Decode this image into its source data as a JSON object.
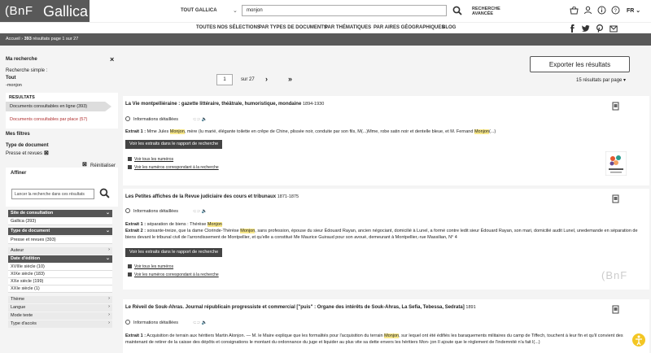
{
  "header": {
    "logo_bnf": "(BnF",
    "logo_gallica": "Gallica",
    "library": "TOUT GALLICA",
    "search_value": "monjon",
    "advanced_line1": "RECHERCHE",
    "advanced_line2": "AVANCÉE",
    "lang": "FR"
  },
  "nav": {
    "items": [
      "TOUTES NOS SÉLECTIONS",
      "PAR TYPES DE DOCUMENTS",
      "PAR THÉMATIQUES",
      "PAR AIRES GÉOGRAPHIQUES",
      "BLOG"
    ]
  },
  "breadcrumb": {
    "home": "Accueil",
    "count": "393",
    "rest": "résultats page 1 sur 27"
  },
  "sidebar": {
    "ma_recherche": "Ma recherche",
    "close": "×",
    "simple_label": "Recherche simple :",
    "scope": "Tout",
    "term": "-monjon",
    "resultats": "RESULTATS",
    "online": "Documents consultables en ligne (393)",
    "onsite": "Documents consultables par place (57)",
    "mes_filtres": "Mes filtres",
    "type_doc": "Type de document",
    "presse": "Presse et revues",
    "reset": "Réinitialiser",
    "affiner": "Affiner",
    "affiner_placeholder": "Lancer la recherche dans ces résultats",
    "facet_site": "Site de consultation",
    "gallica": "Gallica (393)",
    "facet_type": "Type de document",
    "presse_count": "Presse et revues (393)",
    "facet_auteur": "Auteur",
    "facet_date": "Date d'édition",
    "centuries": [
      "XVIIIe siècle (10)",
      "XIXe siècle (183)",
      "XXe siècle (199)",
      "XXIe siècle (1)"
    ],
    "facets_more": [
      "Thème",
      "Langue",
      "Mode texte",
      "Type d'accès"
    ]
  },
  "toolbar": {
    "export": "Exporter les résultats",
    "page_value": "1",
    "sur": "sur 27",
    "per_page": "15 résultats par page"
  },
  "results": [
    {
      "title": "La Vie montpelliéraine : gazette littéraire, théâtrale, humoristique, mondaine",
      "years": "1894-1930",
      "details": "Informations détaillées",
      "e1_label": "Extrait 1 :",
      "e1_pre": " Mme Jules ",
      "e1_mark": "Monjon",
      "e1_mid": ", mère (lu marié, élégante toilette en crêpe de Chine, plissée noir, conduite par son fils, M(...)Mme, robe satin noir et dentelle bleue, et M. Fernand ",
      "e1_mark2": "Monjon",
      "e1_post": "(...)",
      "button": "Voir les extraits dans le rapport de recherche",
      "link1": "Voir tous les numéros",
      "link2": "Voir les numéros correspondant à la recherche"
    },
    {
      "title": "Les Petites affiches de la Revue judiciaire des cours et tribunaux",
      "years": "1871-1875",
      "details": "Informations détaillées",
      "e1_label": "Extrait 1 :",
      "e1_pre": " séparation de biens : Thérèse ",
      "e1_mark": "Monjon",
      "e2_label": "Extrait 2 :",
      "e2_pre": " soixante-treize, que la dame Clorinde-Thérèse ",
      "e2_mark": "Monjon",
      "e2_post": ", sans profession, épouse du sieur Édouard Rayan, ancien négociant, domicilié à Lunel, a formé contre ledit sieur Édouard Rayan, son mari, domicilié audit Lunel, unedemande en séparation de biens devant le tribunal civil de l'arrondissement de Montpellier, et qu'elle a constitué Me Maurice Guiraud pour son avoué, demeurant à Montpellier,-rue Massilian, N° 4",
      "button": "Voir les extraits dans le rapport de recherche",
      "link1": "Voir tous les numéros",
      "link2": "Voir les numéros correspondant à la recherche",
      "watermark": "(BnF"
    },
    {
      "title": "Le Réveil de Souk-Ahras. Journal républicain progressiste et commercial [\"puis\" : Organe des intérêts de Souk-Ahras, La Sefia, Tebessa, Sedrata]",
      "years": "1891",
      "details": "Informations détaillées",
      "e1_label": "Extrait 1 :",
      "e1_pre": " Acquisition de terrain aux héritiers Martin Alonjon. — M. le Maire explique que les formalités pour l'acquisition du terrain ",
      "e1_mark": "Monjon",
      "e1_post": ", sur lequel ont été édifiés les baraquements militaires du camp de Tiffech, touchent à leur fin et qu'il convient des maintenant de retirer de la caisse des dépôts et consignations le montant du ordonnance du juge et liquider au plus vite sa dette envers les héritiers Mon- jon Il ajoute que le règlement de l'indemnité n'a fait l(...)"
    }
  ],
  "colors": {
    "accent": "#595959",
    "highlight": "#f7e78a",
    "onsite_red": "#b03030"
  }
}
